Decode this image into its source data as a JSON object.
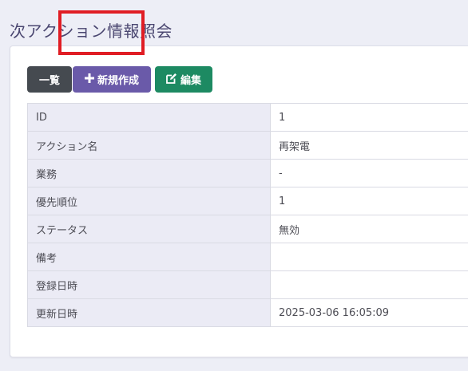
{
  "page": {
    "title": "次アクション情報照会"
  },
  "toolbar": {
    "list_label": "一覧",
    "new_label": "新規作成",
    "edit_label": "編集",
    "new_icon": "plus-icon",
    "edit_icon": "edit-icon"
  },
  "colors": {
    "list_button": "#454a50",
    "new_button": "#6a5aa9",
    "edit_button": "#1d8a62",
    "highlight": "#e01d24",
    "title": "#4a4670"
  },
  "detail": {
    "rows": [
      {
        "label": "ID",
        "value": "1"
      },
      {
        "label": "アクション名",
        "value": "再架電"
      },
      {
        "label": "業務",
        "value": "-"
      },
      {
        "label": "優先順位",
        "value": "1"
      },
      {
        "label": "ステータス",
        "value": "無効"
      },
      {
        "label": "備考",
        "value": ""
      },
      {
        "label": "登録日時",
        "value": ""
      },
      {
        "label": "更新日時",
        "value": "2025-03-06 16:05:09"
      }
    ]
  }
}
